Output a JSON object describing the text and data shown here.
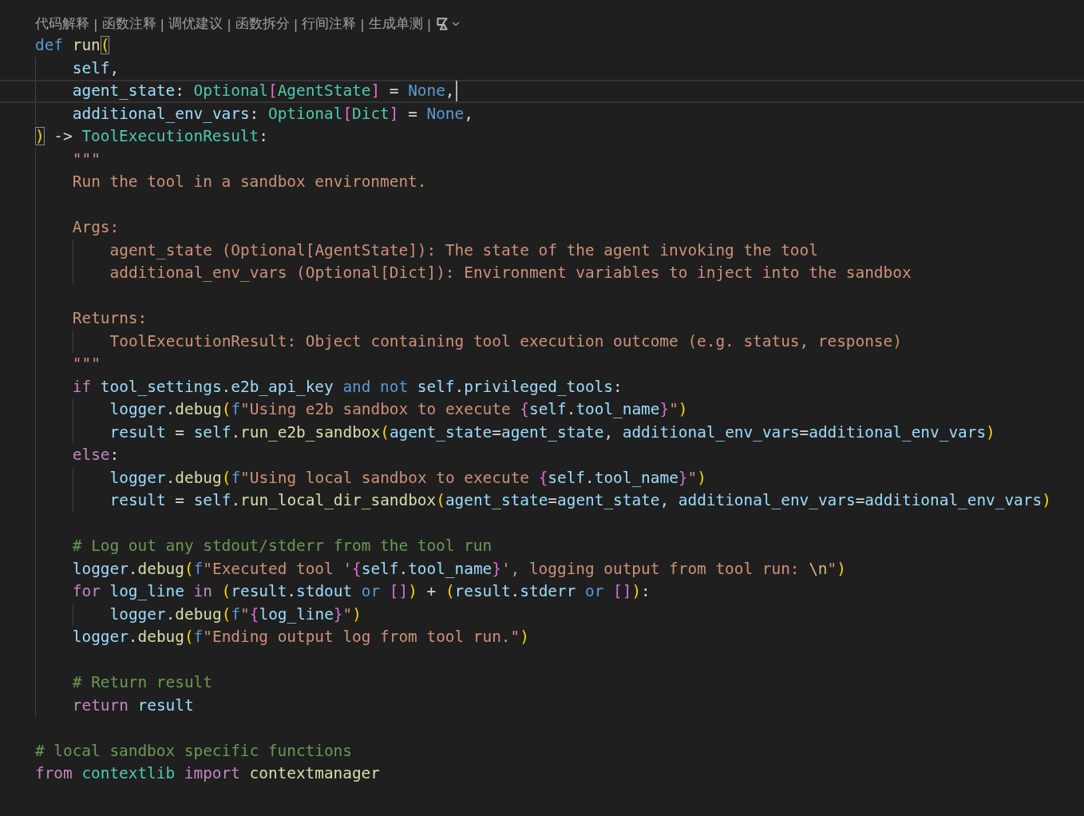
{
  "codelens": {
    "separator": "|",
    "items": [
      "代码解释",
      "函数注释",
      "调优建议",
      "函数拆分",
      "行间注释",
      "生成单测"
    ]
  },
  "lines": [
    {
      "kind": "code",
      "tokens": [
        {
          "text": "def ",
          "kind": "kw"
        },
        {
          "text": "run",
          "kind": "fn"
        },
        {
          "text": "(",
          "kind": "b1m"
        }
      ],
      "children": [
        {
          "kind": "code",
          "tokens": [
            {
              "text": "self",
              "kind": "var"
            },
            {
              "text": ",",
              "kind": "p"
            }
          ]
        },
        {
          "kind": "code",
          "current": true,
          "tokens": [
            {
              "text": "agent_state",
              "kind": "var"
            },
            {
              "text": ": ",
              "kind": "p"
            },
            {
              "text": "Optional",
              "kind": "type"
            },
            {
              "text": "[",
              "kind": "b2"
            },
            {
              "text": "AgentState",
              "kind": "type"
            },
            {
              "text": "]",
              "kind": "b2"
            },
            {
              "text": " = ",
              "kind": "p"
            },
            {
              "text": "None",
              "kind": "kw"
            },
            {
              "text": ",",
              "kind": "p"
            }
          ]
        },
        {
          "kind": "code",
          "tokens": [
            {
              "text": "additional_env_vars",
              "kind": "var"
            },
            {
              "text": ": ",
              "kind": "p"
            },
            {
              "text": "Optional",
              "kind": "type"
            },
            {
              "text": "[",
              "kind": "b2"
            },
            {
              "text": "Dict",
              "kind": "type"
            },
            {
              "text": "]",
              "kind": "b2"
            },
            {
              "text": " = ",
              "kind": "p"
            },
            {
              "text": "None",
              "kind": "kw"
            },
            {
              "text": ",",
              "kind": "p"
            }
          ]
        }
      ]
    },
    {
      "kind": "code",
      "tokens": [
        {
          "text": ")",
          "kind": "b1m"
        },
        {
          "text": " -> ",
          "kind": "p"
        },
        {
          "text": "ToolExecutionResult",
          "kind": "type"
        },
        {
          "text": ":",
          "kind": "p"
        }
      ],
      "children": [
        {
          "kind": "code",
          "tokens": [
            {
              "text": "\"\"\"",
              "kind": "str"
            }
          ]
        },
        {
          "kind": "code",
          "tokens": [
            {
              "text": "Run the tool in a sandbox environment.",
              "kind": "str"
            }
          ]
        },
        {
          "kind": "blank"
        },
        {
          "kind": "code",
          "tokens": [
            {
              "text": "Args:",
              "kind": "str"
            }
          ],
          "children": [
            {
              "kind": "code",
              "tokens": [
                {
                  "text": "agent_state (Optional[AgentState]): The state of the agent invoking the tool",
                  "kind": "str"
                }
              ]
            },
            {
              "kind": "code",
              "tokens": [
                {
                  "text": "additional_env_vars (Optional[Dict]): Environment variables to inject into the sandbox",
                  "kind": "str"
                }
              ]
            }
          ]
        },
        {
          "kind": "blank"
        },
        {
          "kind": "code",
          "tokens": [
            {
              "text": "Returns:",
              "kind": "str"
            }
          ],
          "children": [
            {
              "kind": "code",
              "tokens": [
                {
                  "text": "ToolExecutionResult: Object containing tool execution outcome (e.g. status, response)",
                  "kind": "str"
                }
              ]
            }
          ]
        },
        {
          "kind": "code",
          "tokens": [
            {
              "text": "\"\"\"",
              "kind": "str"
            }
          ]
        },
        {
          "kind": "code",
          "tokens": [
            {
              "text": "if ",
              "kind": "ctl"
            },
            {
              "text": "tool_settings",
              "kind": "var"
            },
            {
              "text": ".",
              "kind": "p"
            },
            {
              "text": "e2b_api_key ",
              "kind": "var"
            },
            {
              "text": "and ",
              "kind": "kw"
            },
            {
              "text": "not ",
              "kind": "kw"
            },
            {
              "text": "self",
              "kind": "var"
            },
            {
              "text": ".",
              "kind": "p"
            },
            {
              "text": "privileged_tools",
              "kind": "var"
            },
            {
              "text": ":",
              "kind": "p"
            }
          ],
          "children": [
            {
              "kind": "code",
              "tokens": [
                {
                  "text": "logger",
                  "kind": "var"
                },
                {
                  "text": ".",
                  "kind": "p"
                },
                {
                  "text": "debug",
                  "kind": "fn"
                },
                {
                  "text": "(",
                  "kind": "b1"
                },
                {
                  "text": "f",
                  "kind": "kw"
                },
                {
                  "text": "\"Using e2b sandbox to execute ",
                  "kind": "str"
                },
                {
                  "text": "{",
                  "kind": "b2"
                },
                {
                  "text": "self",
                  "kind": "var"
                },
                {
                  "text": ".",
                  "kind": "p"
                },
                {
                  "text": "tool_name",
                  "kind": "var"
                },
                {
                  "text": "}",
                  "kind": "b2"
                },
                {
                  "text": "\"",
                  "kind": "str"
                },
                {
                  "text": ")",
                  "kind": "b1"
                }
              ]
            },
            {
              "kind": "code",
              "tokens": [
                {
                  "text": "result",
                  "kind": "var"
                },
                {
                  "text": " = ",
                  "kind": "p"
                },
                {
                  "text": "self",
                  "kind": "var"
                },
                {
                  "text": ".",
                  "kind": "p"
                },
                {
                  "text": "run_e2b_sandbox",
                  "kind": "fn"
                },
                {
                  "text": "(",
                  "kind": "b1"
                },
                {
                  "text": "agent_state",
                  "kind": "var"
                },
                {
                  "text": "=",
                  "kind": "p"
                },
                {
                  "text": "agent_state",
                  "kind": "var"
                },
                {
                  "text": ", ",
                  "kind": "p"
                },
                {
                  "text": "additional_env_vars",
                  "kind": "var"
                },
                {
                  "text": "=",
                  "kind": "p"
                },
                {
                  "text": "additional_env_vars",
                  "kind": "var"
                },
                {
                  "text": ")",
                  "kind": "b1"
                }
              ]
            }
          ]
        },
        {
          "kind": "code",
          "tokens": [
            {
              "text": "else",
              "kind": "ctl"
            },
            {
              "text": ":",
              "kind": "p"
            }
          ],
          "children": [
            {
              "kind": "code",
              "tokens": [
                {
                  "text": "logger",
                  "kind": "var"
                },
                {
                  "text": ".",
                  "kind": "p"
                },
                {
                  "text": "debug",
                  "kind": "fn"
                },
                {
                  "text": "(",
                  "kind": "b1"
                },
                {
                  "text": "f",
                  "kind": "kw"
                },
                {
                  "text": "\"Using local sandbox to execute ",
                  "kind": "str"
                },
                {
                  "text": "{",
                  "kind": "b2"
                },
                {
                  "text": "self",
                  "kind": "var"
                },
                {
                  "text": ".",
                  "kind": "p"
                },
                {
                  "text": "tool_name",
                  "kind": "var"
                },
                {
                  "text": "}",
                  "kind": "b2"
                },
                {
                  "text": "\"",
                  "kind": "str"
                },
                {
                  "text": ")",
                  "kind": "b1"
                }
              ]
            },
            {
              "kind": "code",
              "tokens": [
                {
                  "text": "result",
                  "kind": "var"
                },
                {
                  "text": " = ",
                  "kind": "p"
                },
                {
                  "text": "self",
                  "kind": "var"
                },
                {
                  "text": ".",
                  "kind": "p"
                },
                {
                  "text": "run_local_dir_sandbox",
                  "kind": "fn"
                },
                {
                  "text": "(",
                  "kind": "b1"
                },
                {
                  "text": "agent_state",
                  "kind": "var"
                },
                {
                  "text": "=",
                  "kind": "p"
                },
                {
                  "text": "agent_state",
                  "kind": "var"
                },
                {
                  "text": ", ",
                  "kind": "p"
                },
                {
                  "text": "additional_env_vars",
                  "kind": "var"
                },
                {
                  "text": "=",
                  "kind": "p"
                },
                {
                  "text": "additional_env_vars",
                  "kind": "var"
                },
                {
                  "text": ")",
                  "kind": "b1"
                }
              ]
            }
          ]
        },
        {
          "kind": "blank"
        },
        {
          "kind": "code",
          "tokens": [
            {
              "text": "# Log out any stdout/stderr from the tool run",
              "kind": "com"
            }
          ]
        },
        {
          "kind": "code",
          "tokens": [
            {
              "text": "logger",
              "kind": "var"
            },
            {
              "text": ".",
              "kind": "p"
            },
            {
              "text": "debug",
              "kind": "fn"
            },
            {
              "text": "(",
              "kind": "b1"
            },
            {
              "text": "f",
              "kind": "kw"
            },
            {
              "text": "\"Executed tool '",
              "kind": "str"
            },
            {
              "text": "{",
              "kind": "b2"
            },
            {
              "text": "self",
              "kind": "var"
            },
            {
              "text": ".",
              "kind": "p"
            },
            {
              "text": "tool_name",
              "kind": "var"
            },
            {
              "text": "}",
              "kind": "b2"
            },
            {
              "text": "', logging output from tool run: ",
              "kind": "str"
            },
            {
              "text": "\\n",
              "kind": "esc"
            },
            {
              "text": "\"",
              "kind": "str"
            },
            {
              "text": ")",
              "kind": "b1"
            }
          ]
        },
        {
          "kind": "code",
          "tokens": [
            {
              "text": "for ",
              "kind": "ctl"
            },
            {
              "text": "log_line ",
              "kind": "var"
            },
            {
              "text": "in ",
              "kind": "ctl"
            },
            {
              "text": "(",
              "kind": "b1"
            },
            {
              "text": "result",
              "kind": "var"
            },
            {
              "text": ".",
              "kind": "p"
            },
            {
              "text": "stdout ",
              "kind": "var"
            },
            {
              "text": "or ",
              "kind": "kw"
            },
            {
              "text": "[]",
              "kind": "b2"
            },
            {
              "text": ")",
              "kind": "b1"
            },
            {
              "text": " + ",
              "kind": "p"
            },
            {
              "text": "(",
              "kind": "b1"
            },
            {
              "text": "result",
              "kind": "var"
            },
            {
              "text": ".",
              "kind": "p"
            },
            {
              "text": "stderr ",
              "kind": "var"
            },
            {
              "text": "or ",
              "kind": "kw"
            },
            {
              "text": "[]",
              "kind": "b2"
            },
            {
              "text": ")",
              "kind": "b1"
            },
            {
              "text": ":",
              "kind": "p"
            }
          ],
          "children": [
            {
              "kind": "code",
              "tokens": [
                {
                  "text": "logger",
                  "kind": "var"
                },
                {
                  "text": ".",
                  "kind": "p"
                },
                {
                  "text": "debug",
                  "kind": "fn"
                },
                {
                  "text": "(",
                  "kind": "b1"
                },
                {
                  "text": "f",
                  "kind": "kw"
                },
                {
                  "text": "\"",
                  "kind": "str"
                },
                {
                  "text": "{",
                  "kind": "b2"
                },
                {
                  "text": "log_line",
                  "kind": "var"
                },
                {
                  "text": "}",
                  "kind": "b2"
                },
                {
                  "text": "\"",
                  "kind": "str"
                },
                {
                  "text": ")",
                  "kind": "b1"
                }
              ]
            }
          ]
        },
        {
          "kind": "code",
          "tokens": [
            {
              "text": "logger",
              "kind": "var"
            },
            {
              "text": ".",
              "kind": "p"
            },
            {
              "text": "debug",
              "kind": "fn"
            },
            {
              "text": "(",
              "kind": "b1"
            },
            {
              "text": "f",
              "kind": "kw"
            },
            {
              "text": "\"Ending output log from tool run.\"",
              "kind": "str"
            },
            {
              "text": ")",
              "kind": "b1"
            }
          ]
        },
        {
          "kind": "blank"
        },
        {
          "kind": "code",
          "tokens": [
            {
              "text": "# Return result",
              "kind": "com"
            }
          ]
        },
        {
          "kind": "code",
          "tokens": [
            {
              "text": "return ",
              "kind": "ctl"
            },
            {
              "text": "result",
              "kind": "var"
            }
          ]
        }
      ]
    },
    {
      "kind": "blank"
    },
    {
      "kind": "code",
      "tokens": [
        {
          "text": "# local sandbox specific functions",
          "kind": "com"
        }
      ]
    },
    {
      "kind": "code",
      "tokens": [
        {
          "text": "from ",
          "kind": "ctl"
        },
        {
          "text": "contextlib ",
          "kind": "type"
        },
        {
          "text": "import ",
          "kind": "ctl"
        },
        {
          "text": "contextmanager",
          "kind": "fn"
        }
      ]
    }
  ]
}
